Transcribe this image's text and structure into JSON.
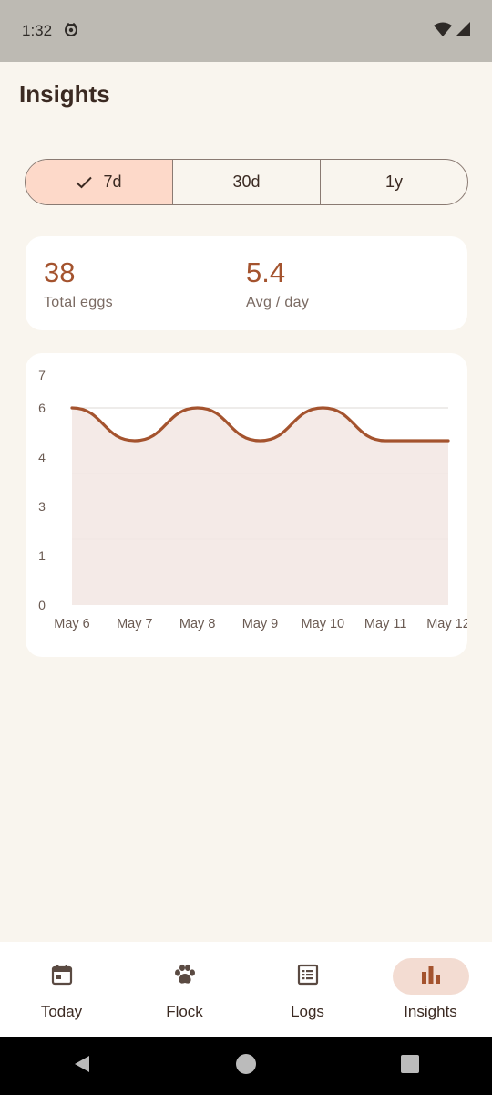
{
  "status_bar": {
    "time": "1:32"
  },
  "page": {
    "title": "Insights"
  },
  "range_selector": {
    "options": [
      {
        "label": "7d",
        "selected": true
      },
      {
        "label": "30d",
        "selected": false
      },
      {
        "label": "1y",
        "selected": false
      }
    ]
  },
  "stats": {
    "total_eggs": {
      "value": "38",
      "label": "Total eggs"
    },
    "avg_per_day": {
      "value": "5.4",
      "label": "Avg / day"
    }
  },
  "chart_data": {
    "type": "area",
    "categories": [
      "May 6",
      "May 7",
      "May 8",
      "May 9",
      "May 10",
      "May 11",
      "May 12"
    ],
    "series": [
      {
        "values": [
          6,
          5,
          6,
          5,
          6,
          5,
          5
        ]
      }
    ],
    "y_tick_labels": [
      "0",
      "1",
      "3",
      "4",
      "6",
      "7"
    ],
    "ylim": [
      0,
      7
    ],
    "grid": true,
    "colors": {
      "line": "#a4532e",
      "fill": "#f3e8e4",
      "grid": "#ddd8d4"
    }
  },
  "bottom_nav": {
    "items": [
      {
        "label": "Today",
        "icon": "calendar-icon",
        "active": false
      },
      {
        "label": "Flock",
        "icon": "paw-icon",
        "active": false
      },
      {
        "label": "Logs",
        "icon": "list-icon",
        "active": false
      },
      {
        "label": "Insights",
        "icon": "bar-chart-icon",
        "active": true
      }
    ]
  },
  "colors": {
    "accent": "#a4532e",
    "background": "#f9f5ee",
    "selected_segment": "#fdd9c9",
    "active_nav_pill": "#f3dcd2"
  }
}
